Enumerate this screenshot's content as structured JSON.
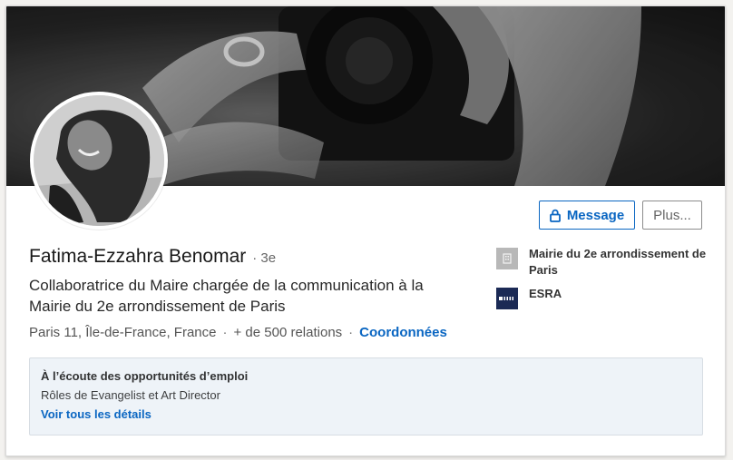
{
  "profile": {
    "name": "Fatima-Ezzahra Benomar",
    "degree": "· 3e",
    "headline": "Collaboratrice du Maire chargée de la communication à la Mairie du 2e arrondissement de Paris",
    "location": "Paris 11, Île-de-France, France",
    "connections": "+ de 500 relations",
    "contact_link": "Coordonnées"
  },
  "actions": {
    "message_label": "Message",
    "message_icon": "lock-icon",
    "more_label": "Plus..."
  },
  "organizations": [
    {
      "name": "Mairie du 2e arrondissement de Paris",
      "logo": "building-icon"
    },
    {
      "name": "ESRA",
      "logo": "esra-logo"
    }
  ],
  "opportunities": {
    "title": "À l’écoute des opportunités d’emploi",
    "roles": "Rôles de Evangelist et Art Director",
    "details_link": "Voir tous les détails"
  },
  "colors": {
    "accent": "#0a66c2",
    "panel_background": "#eef3f8",
    "esra_logo": "#1b2a55"
  }
}
